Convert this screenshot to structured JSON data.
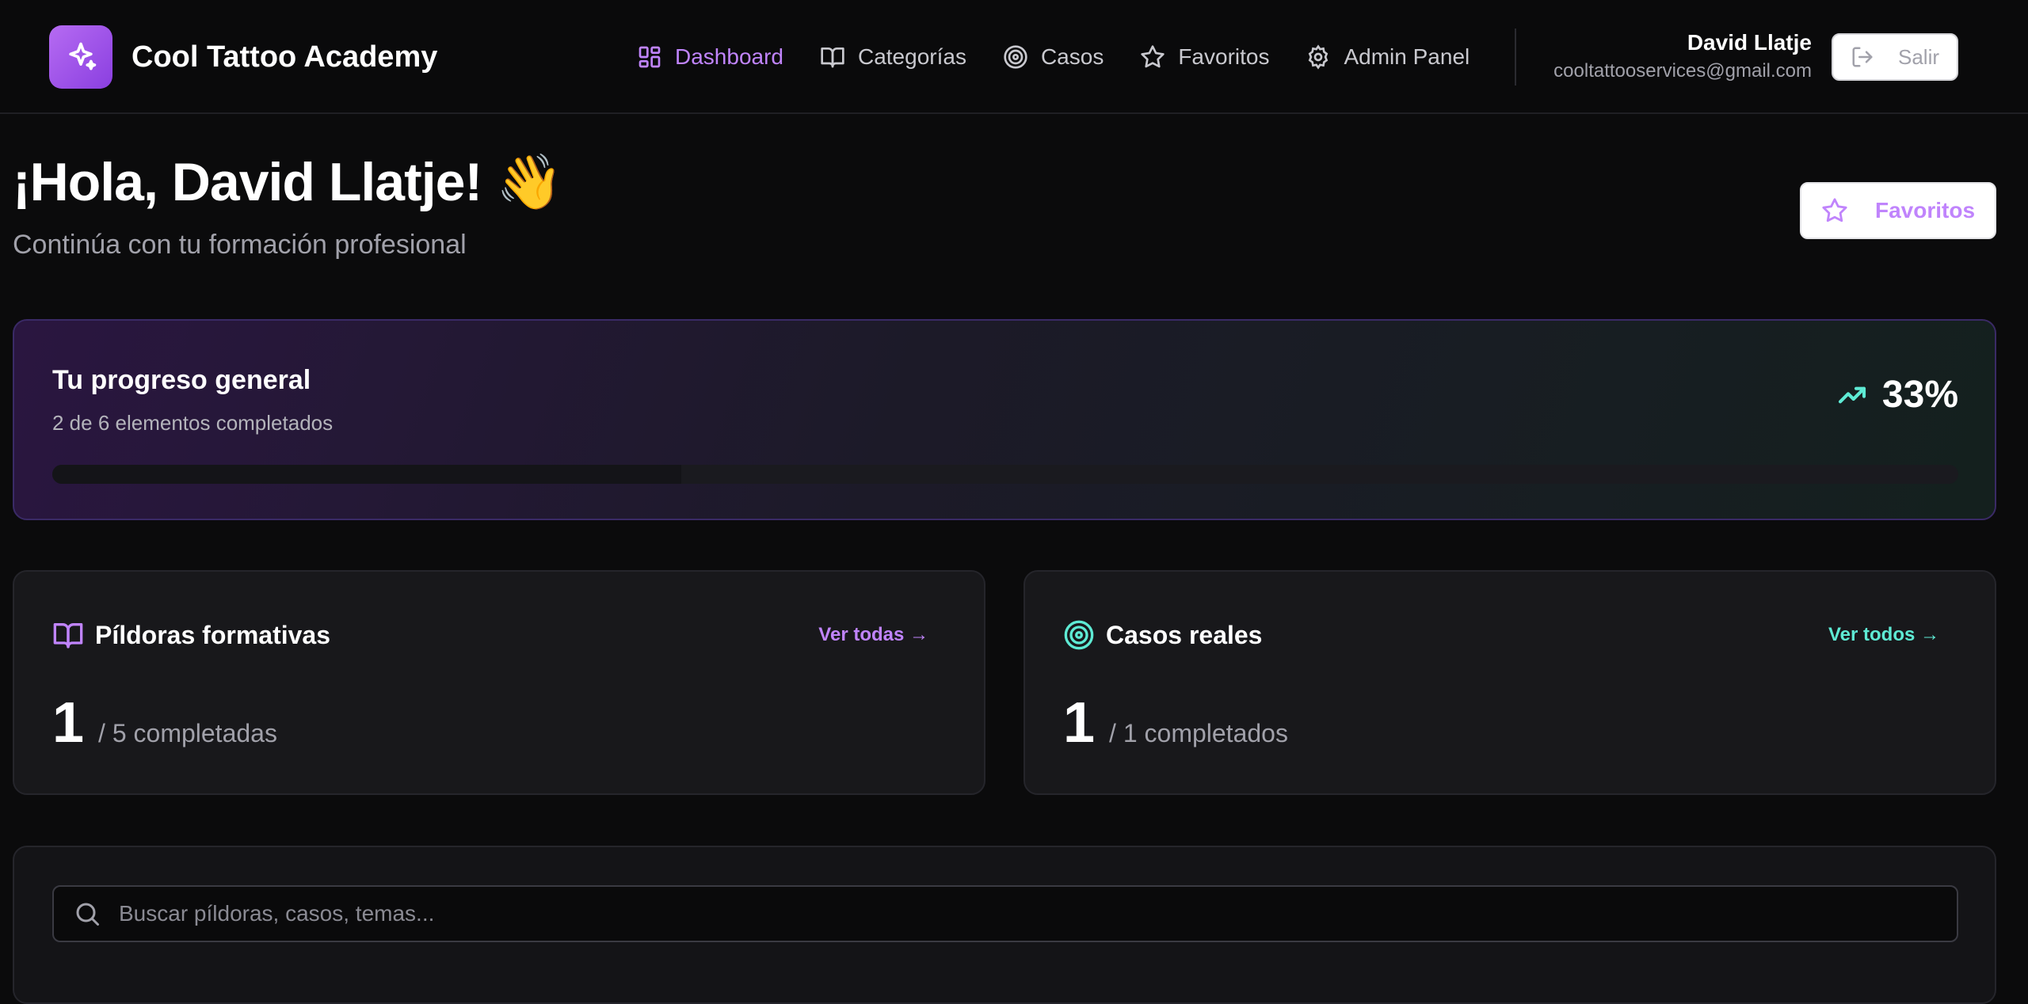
{
  "brand": {
    "title": "Cool Tattoo Academy",
    "logo_icon": "sparkles-icon",
    "accent": "#a855f7"
  },
  "nav": {
    "items": [
      {
        "label": "Dashboard",
        "icon": "layout-grid-icon",
        "active": true
      },
      {
        "label": "Categorías",
        "icon": "book-open-icon",
        "active": false
      },
      {
        "label": "Casos",
        "icon": "target-icon",
        "active": false
      },
      {
        "label": "Favoritos",
        "icon": "star-icon",
        "active": false
      },
      {
        "label": "Admin Panel",
        "icon": "gear-icon",
        "active": false
      }
    ]
  },
  "user": {
    "name": "David Llatje",
    "email": "cooltattooservices@gmail.com",
    "logout_label": "Salir"
  },
  "greeting": {
    "title": "¡Hola, David Llatje! 👋",
    "subtitle": "Continúa con tu formación profesional",
    "favorites_button": "Favoritos"
  },
  "progress": {
    "title": "Tu progreso general",
    "subtitle": "2 de 6 elementos completados",
    "percent_label": "33%",
    "percent": 33,
    "accent": "#5eead4"
  },
  "stats": {
    "pildoras": {
      "title": "Píldoras formativas",
      "link": "Ver todas →",
      "count": "1",
      "suffix": "/ 5 completadas",
      "accent": "#c084fc"
    },
    "casos": {
      "title": "Casos reales",
      "link": "Ver todos →",
      "count": "1",
      "suffix": "/ 1 completados",
      "accent": "#5eead4"
    }
  },
  "search": {
    "placeholder": "Buscar píldoras, casos, temas..."
  }
}
